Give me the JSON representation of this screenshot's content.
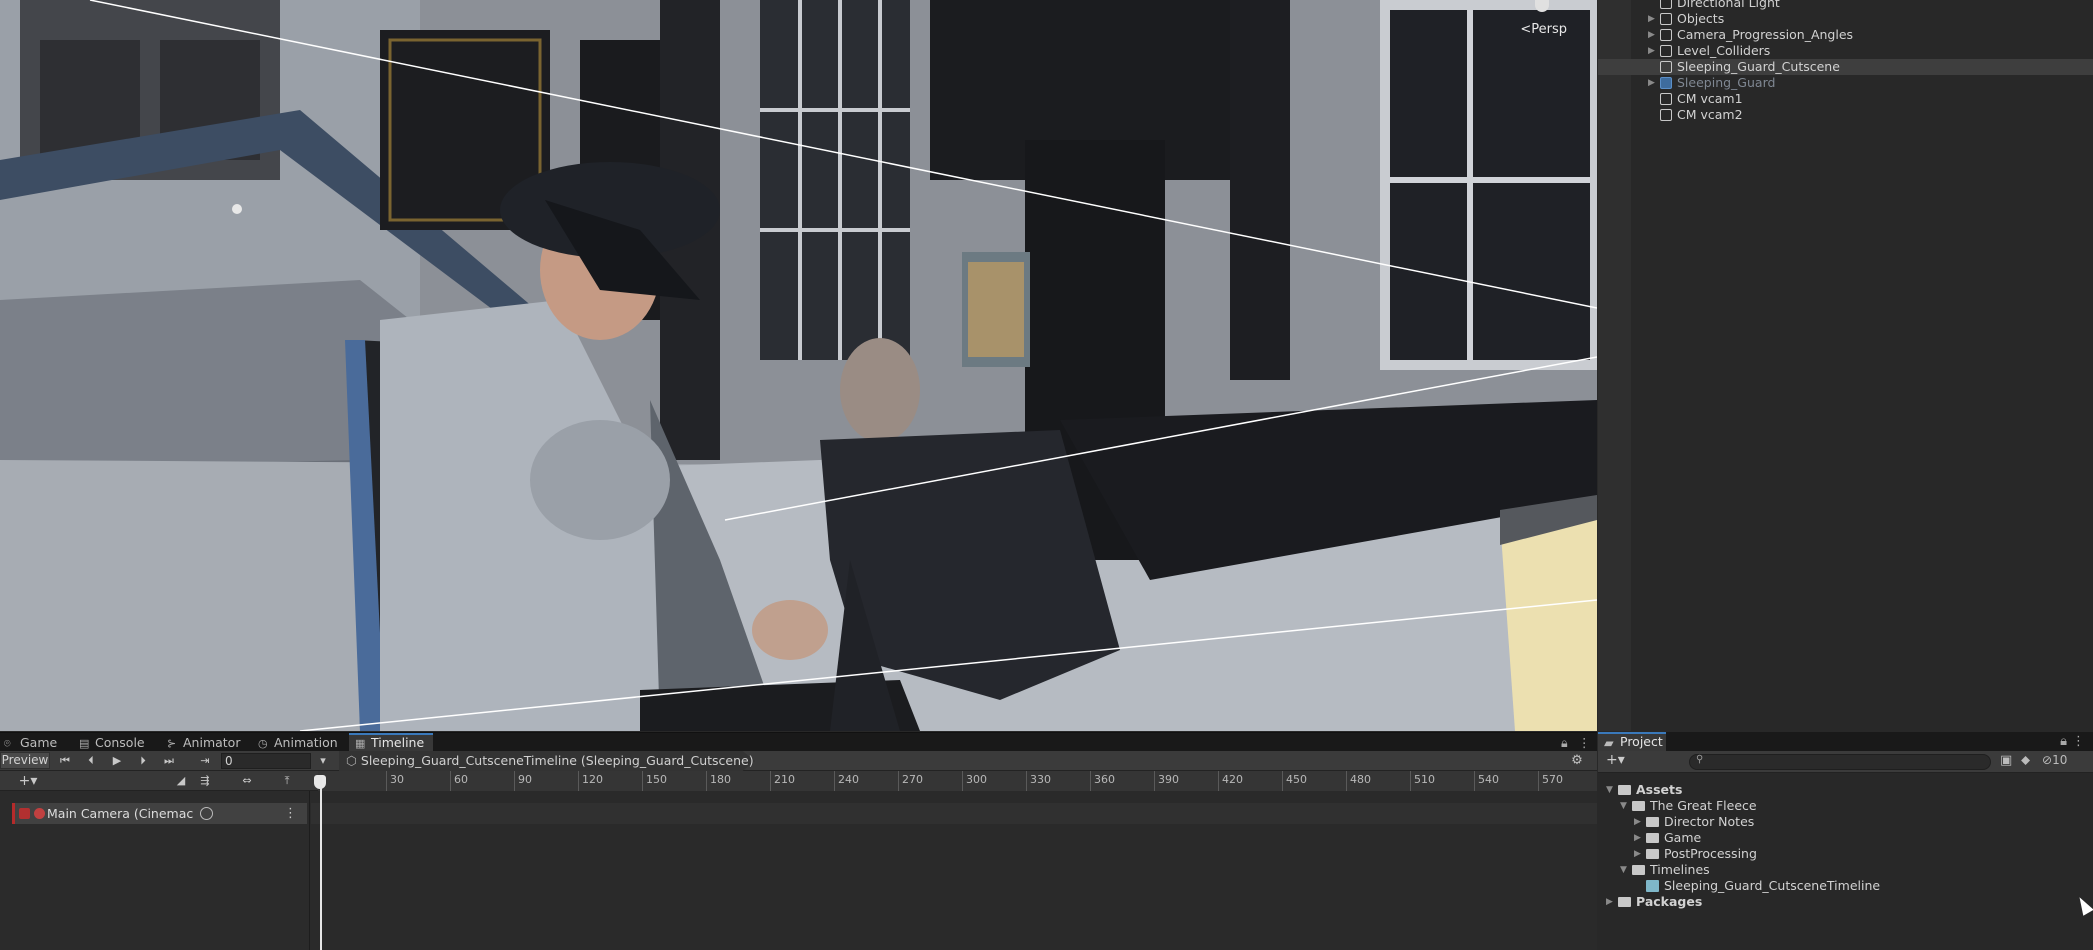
{
  "scene": {
    "view_mode": "Persp"
  },
  "hierarchy": {
    "items": [
      {
        "label": "Directional Light",
        "has_children": false,
        "selected": false,
        "dim": false
      },
      {
        "label": "Objects",
        "has_children": true,
        "selected": false,
        "dim": false
      },
      {
        "label": "Camera_Progression_Angles",
        "has_children": true,
        "selected": false,
        "dim": false
      },
      {
        "label": "Level_Colliders",
        "has_children": true,
        "selected": false,
        "dim": false
      },
      {
        "label": "Sleeping_Guard_Cutscene",
        "has_children": false,
        "selected": true,
        "dim": false
      },
      {
        "label": "Sleeping_Guard",
        "has_children": true,
        "selected": false,
        "dim": true
      },
      {
        "label": "CM vcam1",
        "has_children": false,
        "selected": false,
        "dim": false
      },
      {
        "label": "CM vcam2",
        "has_children": false,
        "selected": false,
        "dim": false
      }
    ]
  },
  "bottom_tabs": [
    {
      "label": "Game",
      "icon": "gamepad-icon",
      "active": false
    },
    {
      "label": "Console",
      "icon": "console-icon",
      "active": false
    },
    {
      "label": "Animator",
      "icon": "animator-icon",
      "active": false
    },
    {
      "label": "Animation",
      "icon": "animation-icon",
      "active": false
    },
    {
      "label": "Timeline",
      "icon": "timeline-icon",
      "active": true
    }
  ],
  "timeline": {
    "preview_label": "Preview",
    "frame_value": "0",
    "breadcrumb": "Sleeping_Guard_CutsceneTimeline (Sleeping_Guard_Cutscene)",
    "ruler_ticks": [
      "30",
      "60",
      "90",
      "120",
      "150",
      "180",
      "210",
      "240",
      "270",
      "300",
      "330",
      "360",
      "390",
      "420",
      "450",
      "480",
      "510",
      "540",
      "570"
    ],
    "tracks": [
      {
        "label": "Main Camera (Cinemac"
      }
    ]
  },
  "project": {
    "tab_label": "Project",
    "badge_count": "10",
    "tree": [
      {
        "label": "Assets",
        "depth": 0,
        "expanded": true,
        "bold": true,
        "kind": "folder"
      },
      {
        "label": "The Great Fleece",
        "depth": 1,
        "expanded": true,
        "bold": false,
        "kind": "folder"
      },
      {
        "label": "Director Notes",
        "depth": 2,
        "expanded": false,
        "bold": false,
        "kind": "folder"
      },
      {
        "label": "Game",
        "depth": 2,
        "expanded": false,
        "bold": false,
        "kind": "folder"
      },
      {
        "label": "PostProcessing",
        "depth": 2,
        "expanded": false,
        "bold": false,
        "kind": "folder"
      },
      {
        "label": "Timelines",
        "depth": 1,
        "expanded": true,
        "bold": false,
        "kind": "folder"
      },
      {
        "label": "Sleeping_Guard_CutsceneTimeline",
        "depth": 2,
        "expanded": null,
        "bold": false,
        "kind": "timeline-asset"
      },
      {
        "label": "Packages",
        "depth": 0,
        "expanded": false,
        "bold": true,
        "kind": "folder"
      }
    ]
  }
}
